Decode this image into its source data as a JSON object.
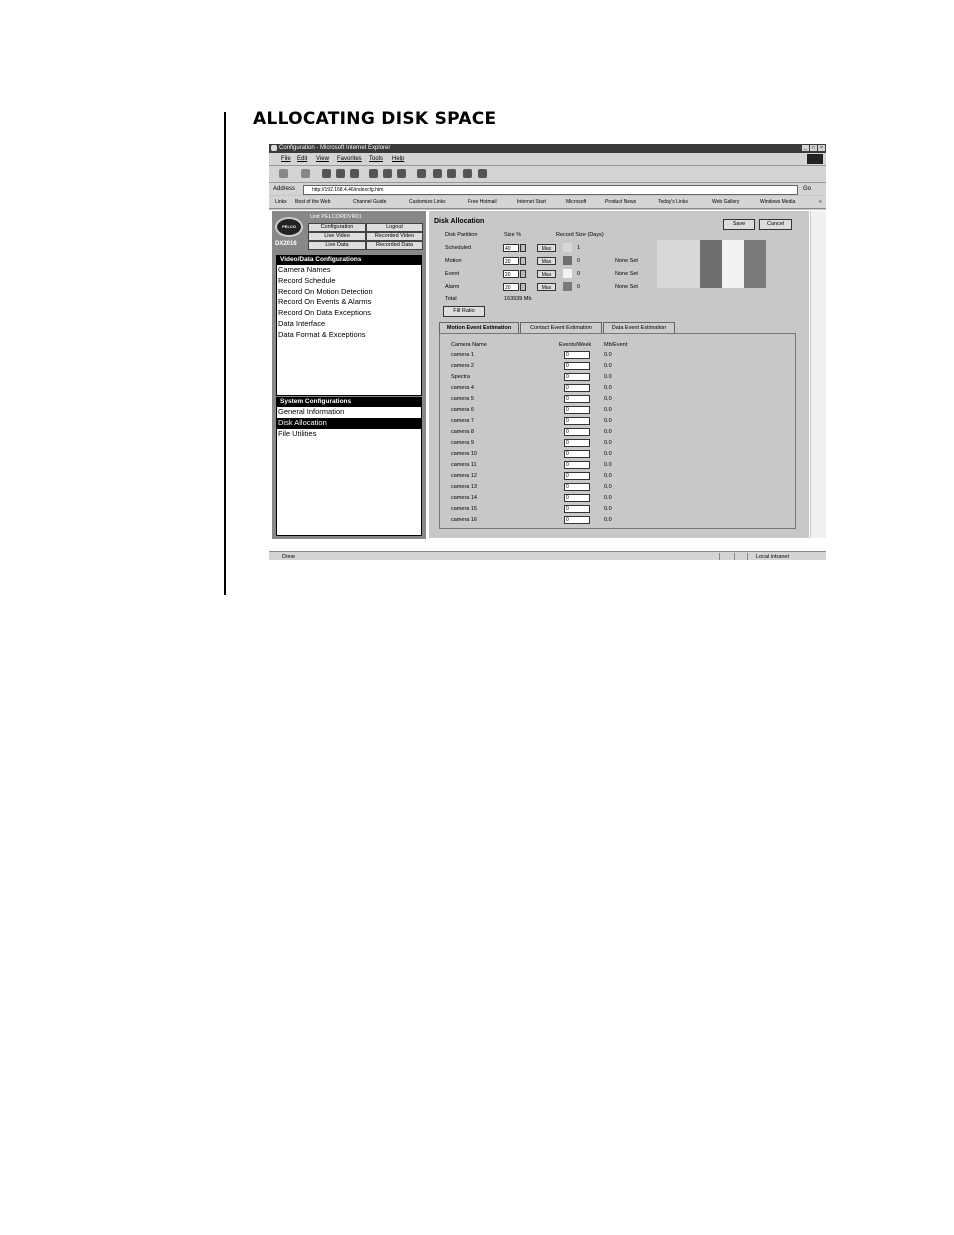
{
  "page": {
    "heading": "ALLOCATING DISK SPACE"
  },
  "browser": {
    "title": "Configuration - Microsoft Internet Explorer",
    "menu": [
      "File",
      "Edit",
      "View",
      "Favorites",
      "Tools",
      "Help"
    ],
    "address_label": "Address",
    "url": "http://192.168.4.46/indexcfg.htm",
    "go_label": "Go",
    "links_label": "Links",
    "links": [
      "Best of the Web",
      "Channel Guide",
      "Customize Links",
      "Free Hotmail",
      "Internet Start",
      "Microsoft",
      "Product News",
      "Today's Links",
      "Web Gallery",
      "Windows Media"
    ],
    "status_text": "Done",
    "zone_text": "Local intranet"
  },
  "app": {
    "logo_text": "PELCO",
    "unit_label": "Unit  PELCORDVR01",
    "model": "DX2016",
    "nav": {
      "configuration": "Configuration",
      "logout": "Logout",
      "live_video": "Live Video",
      "recorded_video": "Recorded Video",
      "live_data": "Live Data",
      "recorded_data": "Recorded Data"
    },
    "video_data_header": "Video/Data Configurations",
    "video_data_items": [
      "Camera Names",
      "Record Schedule",
      "Record On Motion Detection",
      "Record On Events & Alarms",
      "Record On Data Exceptions",
      "Data Interface",
      "Data Format & Exceptions"
    ],
    "system_header": "System Configurations",
    "system_items": [
      "General Information",
      "Disk Allocation",
      "File Utilities"
    ],
    "system_selected": "Disk Allocation"
  },
  "disk_allocation": {
    "title": "Disk Allocation",
    "save_label": "Save",
    "cancel_label": "Cancel",
    "col_partition": "Disk Partition",
    "col_size": "Size %",
    "col_record_size": "Record Size (Days)",
    "max_label": "Max",
    "partitions": [
      {
        "name": "Scheduled",
        "size": "40",
        "days": "1",
        "status": "",
        "color": "#d8d8d8"
      },
      {
        "name": "Motion",
        "size": "20",
        "days": "0",
        "status": "None Set",
        "color": "#6e6e6e"
      },
      {
        "name": "Event",
        "size": "20",
        "days": "0",
        "status": "None Set",
        "color": "#f2f2f2"
      },
      {
        "name": "Alarm",
        "size": "20",
        "days": "0",
        "status": "None Set",
        "color": "#7a7a7a"
      }
    ],
    "total_label": "Total",
    "total_value": "163939 Mb",
    "fill_ratio_label": "Fill Ratio"
  },
  "tabs": [
    "Motion Event Estimation",
    "Contact Event Estimation",
    "Data Event Estimation"
  ],
  "active_tab": "Motion Event Estimation",
  "estimation": {
    "col_camera": "Camera Name",
    "col_events": "Events/Week",
    "col_mb": "Mb/Event",
    "rows": [
      {
        "camera": "camera 1",
        "events": "0",
        "mb": "0.0"
      },
      {
        "camera": "camera 2",
        "events": "0",
        "mb": "0.0"
      },
      {
        "camera": "Spectra",
        "events": "0",
        "mb": "0.0"
      },
      {
        "camera": "camera 4",
        "events": "0",
        "mb": "0.0"
      },
      {
        "camera": "camera 5",
        "events": "0",
        "mb": "0.0"
      },
      {
        "camera": "camera 6",
        "events": "0",
        "mb": "0.0"
      },
      {
        "camera": "camera 7",
        "events": "0",
        "mb": "0.0"
      },
      {
        "camera": "camera 8",
        "events": "0",
        "mb": "0.0"
      },
      {
        "camera": "camera 9",
        "events": "0",
        "mb": "0.0"
      },
      {
        "camera": "camera 10",
        "events": "0",
        "mb": "0.0"
      },
      {
        "camera": "camera 11",
        "events": "0",
        "mb": "0.0"
      },
      {
        "camera": "camera 12",
        "events": "0",
        "mb": "0.0"
      },
      {
        "camera": "camera 13",
        "events": "0",
        "mb": "0.0"
      },
      {
        "camera": "camera 14",
        "events": "0",
        "mb": "0.0"
      },
      {
        "camera": "camera 15",
        "events": "0",
        "mb": "0.0"
      },
      {
        "camera": "camera 16",
        "events": "0",
        "mb": "0.0"
      }
    ]
  }
}
